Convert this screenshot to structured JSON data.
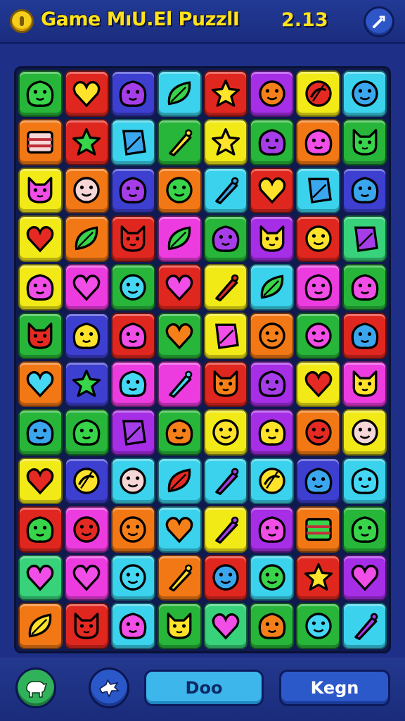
{
  "header": {
    "title": "Game MıU.El PuzzlI",
    "score": "2.13",
    "coin_icon": "coin-icon",
    "settings_icon": "wrench-icon"
  },
  "board": {
    "columns": 8,
    "rows": 12,
    "tile_colors": {
      "G": "#27b53a",
      "R": "#e0271f",
      "B": "#3c3fd0",
      "C": "#3ad2ec",
      "Y": "#f2ea17",
      "P": "#a52ee6",
      "O": "#f27815",
      "M": "#ec3ce0",
      "L": "#37d27a",
      "T": "#2ec6c6"
    },
    "icon_colors": {
      "g": "#38d44a",
      "r": "#e42a22",
      "p": "#a53de8",
      "y": "#ffe32a",
      "o": "#f5801a",
      "b": "#3aa6ee",
      "m": "#f04ee6",
      "w": "#f6d6d6",
      "c": "#45d8f5"
    },
    "grid": [
      [
        "G:blob:g",
        "R:heart:y",
        "B:blob:p",
        "C:leaf:g",
        "R:star:y",
        "P:face:o",
        "Y:swirl:r",
        "C:face:b"
      ],
      [
        "O:flag:w",
        "R:star:g",
        "C:diamond:b",
        "G:wand:y",
        "Y:star:y",
        "G:blob:p",
        "O:blob:m",
        "G:cat:g"
      ],
      [
        "Y:cat:m",
        "O:face:w",
        "B:blob:p",
        "O:face:g",
        "C:wand:b",
        "R:heart:y",
        "C:diamond:b",
        "B:blob:b"
      ],
      [
        "Y:heart:r",
        "O:leaf:g",
        "R:cat:r",
        "M:leaf:g",
        "G:blob:p",
        "P:cat:y",
        "R:face:y",
        "L:diamond:p"
      ],
      [
        "Y:blob:m",
        "M:heart:m",
        "G:face:c",
        "R:heart:m",
        "Y:wand:r",
        "C:leaf:g",
        "M:blob:m",
        "G:blob:m"
      ],
      [
        "G:cat:r",
        "B:blob:y",
        "R:blob:m",
        "G:heart:o",
        "Y:diamond:m",
        "O:face:o",
        "G:face:m",
        "R:blob:b"
      ],
      [
        "O:heart:c",
        "B:star:g",
        "M:blob:c",
        "M:wand:c",
        "R:cat:o",
        "P:blob:p",
        "Y:heart:r",
        "M:cat:y"
      ],
      [
        "G:blob:b",
        "G:blob:g",
        "P:diamond:p",
        "G:blob:o",
        "Y:face:y",
        "P:blob:y",
        "O:face:r",
        "Y:face:w"
      ],
      [
        "Y:heart:r",
        "B:swirl:y",
        "C:face:w",
        "C:leaf:r",
        "C:wand:p",
        "C:swirl:y",
        "B:blob:b",
        "C:blob:c"
      ],
      [
        "R:blob:g",
        "M:face:r",
        "O:face:o",
        "C:heart:o",
        "Y:wand:p",
        "P:blob:m",
        "O:flag:g",
        "G:blob:g"
      ],
      [
        "L:heart:m",
        "M:heart:m",
        "C:face:c",
        "O:wand:y",
        "R:face:b",
        "C:face:g",
        "R:star:y",
        "P:heart:m"
      ],
      [
        "O:leaf:y",
        "R:cat:r",
        "C:blob:m",
        "G:cat:y",
        "L:heart:m",
        "G:blob:o",
        "G:face:c",
        "C:wand:p"
      ]
    ]
  },
  "footer": {
    "left_icon": "animal-icon",
    "mid_icon": "dragon-icon",
    "do_label": "Doo",
    "kegn_label": "Kegn"
  }
}
